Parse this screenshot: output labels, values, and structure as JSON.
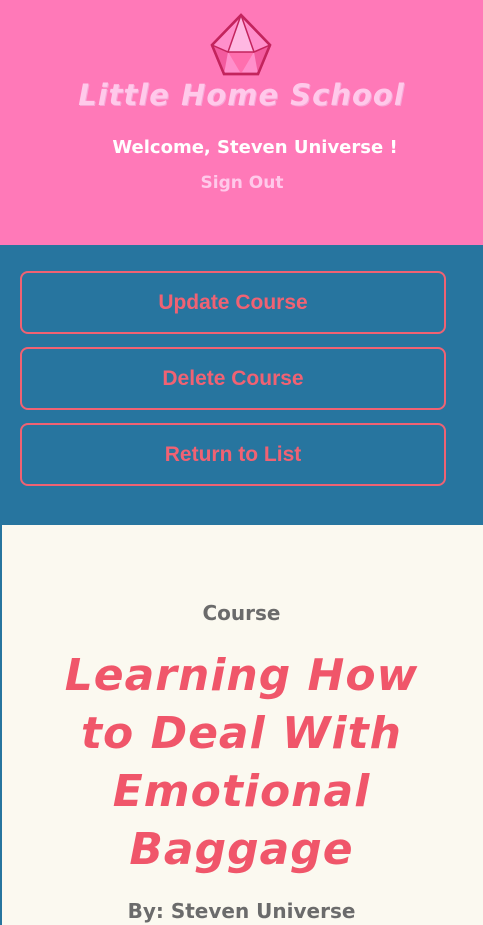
{
  "header": {
    "logo_icon": "gem-icon",
    "site_title": "Little Home School",
    "welcome_text": "Welcome, Steven Universe !",
    "sign_out_label": "Sign Out"
  },
  "actions": {
    "update_label": "Update Course",
    "delete_label": "Delete Course",
    "return_label": "Return to List"
  },
  "course": {
    "section_label": "Course",
    "title": "Learning How to Deal With Emotional Baggage",
    "byline": "By: Steven Universe"
  },
  "colors": {
    "header_bg": "#ff79b8",
    "panel_bg": "#27759f",
    "accent": "#f06273",
    "content_bg": "#fbf9f0",
    "title_light": "#ffc9ea"
  }
}
